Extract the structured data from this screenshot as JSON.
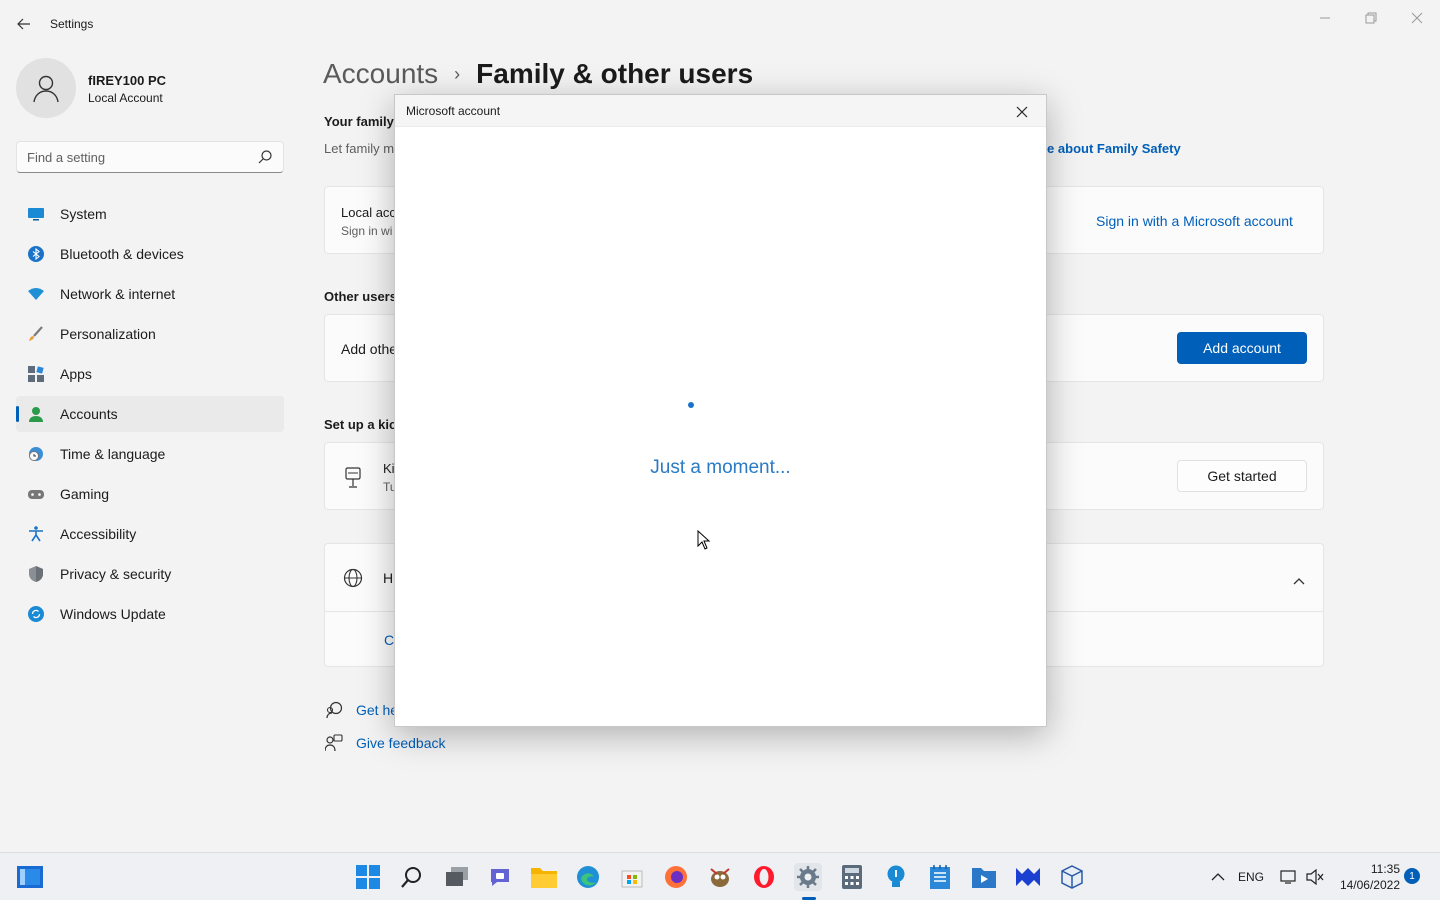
{
  "window": {
    "title": "Settings"
  },
  "profile": {
    "name": "fIREY100 PC",
    "account_type": "Local Account"
  },
  "search": {
    "placeholder": "Find a setting"
  },
  "sidebar": {
    "items": [
      {
        "label": "System",
        "icon": "monitor-icon"
      },
      {
        "label": "Bluetooth & devices",
        "icon": "bluetooth-icon"
      },
      {
        "label": "Network & internet",
        "icon": "wifi-icon"
      },
      {
        "label": "Personalization",
        "icon": "brush-icon"
      },
      {
        "label": "Apps",
        "icon": "apps-icon"
      },
      {
        "label": "Accounts",
        "icon": "person-icon",
        "active": true
      },
      {
        "label": "Time & language",
        "icon": "clock-globe-icon"
      },
      {
        "label": "Gaming",
        "icon": "gamepad-icon"
      },
      {
        "label": "Accessibility",
        "icon": "accessibility-icon"
      },
      {
        "label": "Privacy & security",
        "icon": "shield-icon"
      },
      {
        "label": "Windows Update",
        "icon": "update-icon"
      }
    ]
  },
  "breadcrumb": {
    "parent": "Accounts",
    "separator": "›",
    "current": "Family & other users"
  },
  "family": {
    "title": "Your family",
    "subtitle": "Let family m",
    "learn_more": "re about Family Safety",
    "local_account_label": "Local acc",
    "local_account_sub": "Sign in wi",
    "sign_in_link": "Sign in with a Microsoft account"
  },
  "other_users": {
    "title": "Other users",
    "add_other_label": "Add othe",
    "add_account_button": "Add account"
  },
  "kiosk": {
    "title": "Set up a kio",
    "label": "Ki",
    "sub": "Tu",
    "get_started_button": "Get started"
  },
  "help": {
    "label": "H",
    "link": "C"
  },
  "bottom_links": {
    "get_help": "Get he",
    "give_feedback": "Give feedback"
  },
  "dialog": {
    "title": "Microsoft account",
    "message": "Just a moment..."
  },
  "taskbar": {
    "language": "ENG",
    "time": "11:35",
    "date": "14/06/2022",
    "notification_count": "1"
  },
  "colors": {
    "accent": "#005fb8",
    "dialog_text": "#2a7ac4"
  }
}
